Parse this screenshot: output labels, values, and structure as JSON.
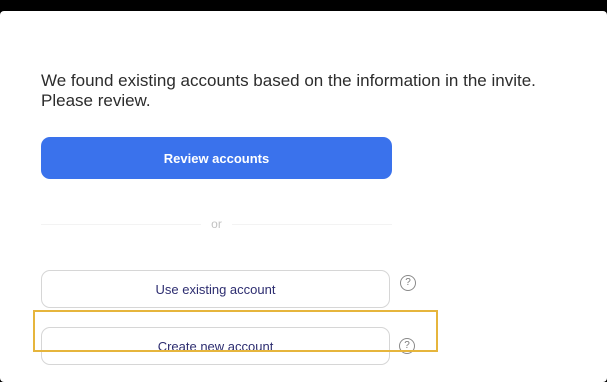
{
  "message": "We found existing accounts based on the information in the invite. Please review.",
  "review_button_label": "Review accounts",
  "divider_label": "or",
  "use_existing_button_label": "Use existing account",
  "create_new_button_label": "Create new account",
  "help_icon_glyph": "?",
  "colors": {
    "primary": "#3a72ec",
    "highlight": "#e6b53c",
    "secondary_text": "#2d2d70"
  },
  "icons": [
    "help-circle-icon"
  ]
}
